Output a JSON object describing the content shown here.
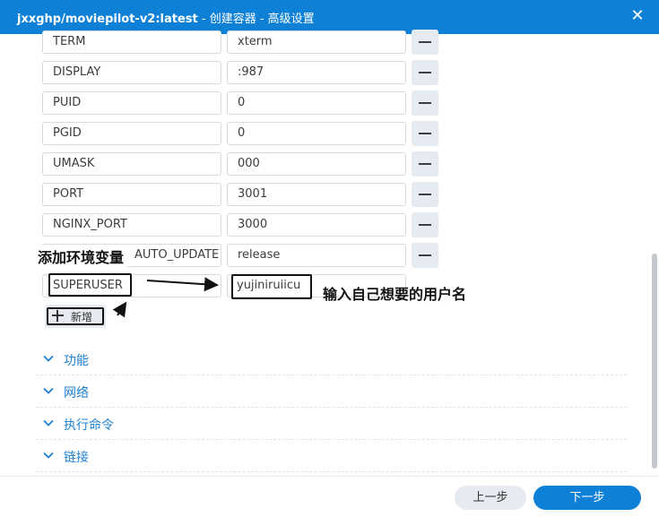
{
  "window": {
    "title_app": "jxxghp/moviepilot-v2:latest",
    "title_rest": " - 创建容器 - 高级设置",
    "close_glyph": "✕"
  },
  "env_rows": [
    {
      "key": "TERM",
      "value": "xterm"
    },
    {
      "key": "DISPLAY",
      "value": ":987"
    },
    {
      "key": "PUID",
      "value": "0"
    },
    {
      "key": "PGID",
      "value": "0"
    },
    {
      "key": "UMASK",
      "value": "000"
    },
    {
      "key": "PORT",
      "value": "3001"
    },
    {
      "key": "NGINX_PORT",
      "value": "3000"
    },
    {
      "key": "AUTO_UPDATE",
      "value": "release"
    },
    {
      "key": "SUPERUSER",
      "value": "yujiniruiicu"
    }
  ],
  "add_button": {
    "label": "新增"
  },
  "annotations": {
    "add_env": "添加环境变量",
    "enter_username": "输入自己想要的用户名"
  },
  "sections": [
    {
      "label": "功能"
    },
    {
      "label": "网络"
    },
    {
      "label": "执行命令"
    },
    {
      "label": "链接"
    }
  ],
  "footer": {
    "prev_label": "上一步",
    "next_label": "下一步"
  },
  "colors": {
    "accent": "#0e81d6",
    "section_text": "#1d7fd1"
  }
}
